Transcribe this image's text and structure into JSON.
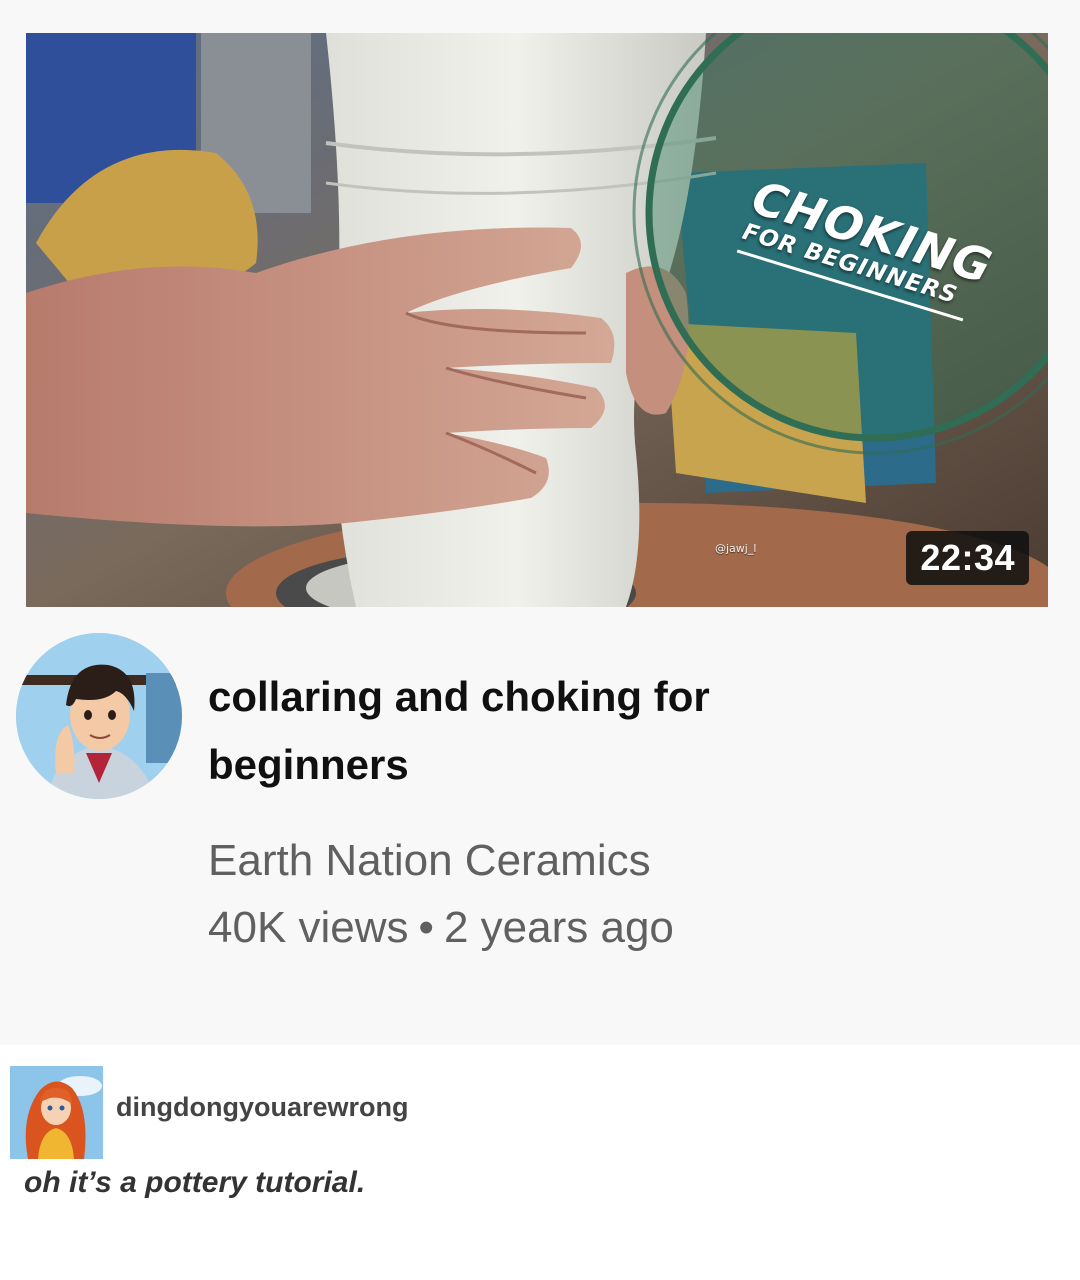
{
  "video": {
    "thumbnail_overlay_title": "CHOKING",
    "thumbnail_overlay_subtitle": "FOR BEGINNERS",
    "watermark": "@jawj_l",
    "duration": "22:34",
    "title": "collaring and choking for beginners",
    "channel": "Earth Nation Ceramics",
    "views": "40K views",
    "separator": "•",
    "age": "2 years ago"
  },
  "post": {
    "username": "dingdongyouarewrong",
    "comment": "oh it’s a pottery tutorial."
  },
  "icons": {
    "channel_avatar": "anime-character-avatar-icon",
    "user_avatar": "anime-character-avatar-icon"
  },
  "colors": {
    "card_background": "#f8f8f8",
    "title_text": "#101010",
    "meta_text": "#606060",
    "duration_badge": "#0f0f0f",
    "overlay_ring": "#2f6d54"
  }
}
